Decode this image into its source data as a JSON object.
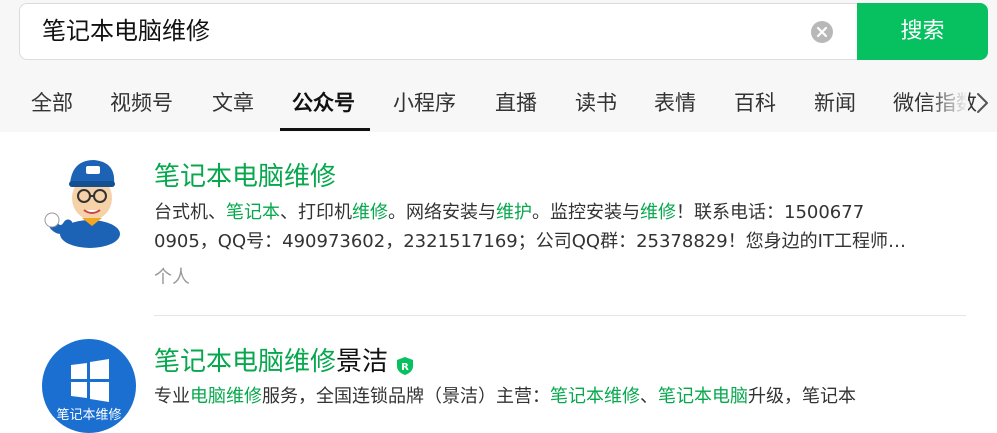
{
  "search": {
    "query": "笔记本电脑维修",
    "button_label": "搜索"
  },
  "tabs": [
    {
      "label": "全部"
    },
    {
      "label": "视频号"
    },
    {
      "label": "文章"
    },
    {
      "label": "公众号"
    },
    {
      "label": "小程序"
    },
    {
      "label": "直播"
    },
    {
      "label": "读书"
    },
    {
      "label": "表情"
    },
    {
      "label": "百科"
    },
    {
      "label": "新闻"
    },
    {
      "label": "微信指数"
    }
  ],
  "active_tab": "公众号",
  "results": [
    {
      "title": "笔记本电脑维修",
      "title_rest": "",
      "desc_line1": [
        "台式机、",
        "笔记本",
        "、打印机",
        "维修",
        "。网络安装与",
        "维护",
        "。监控安装与",
        "维修",
        "！联系电话：1500677"
      ],
      "desc_line2": "0905，QQ号：490973602，2321517169；公司QQ群：25378829！您身边的IT工程师…",
      "meta": "个人"
    },
    {
      "title": "笔记本电脑维修",
      "title_rest": "景洁",
      "verified_badge": "R",
      "desc_line1": [
        "专业",
        "电脑维修",
        "服务，全国连锁品牌（景洁）主营：",
        "笔记本维修",
        "、",
        "笔记本电脑",
        "升级，笔记本"
      ],
      "avatar_text": "笔记本维修"
    }
  ],
  "colors": {
    "accent": "#07c160",
    "highlight": "#07a84d"
  }
}
